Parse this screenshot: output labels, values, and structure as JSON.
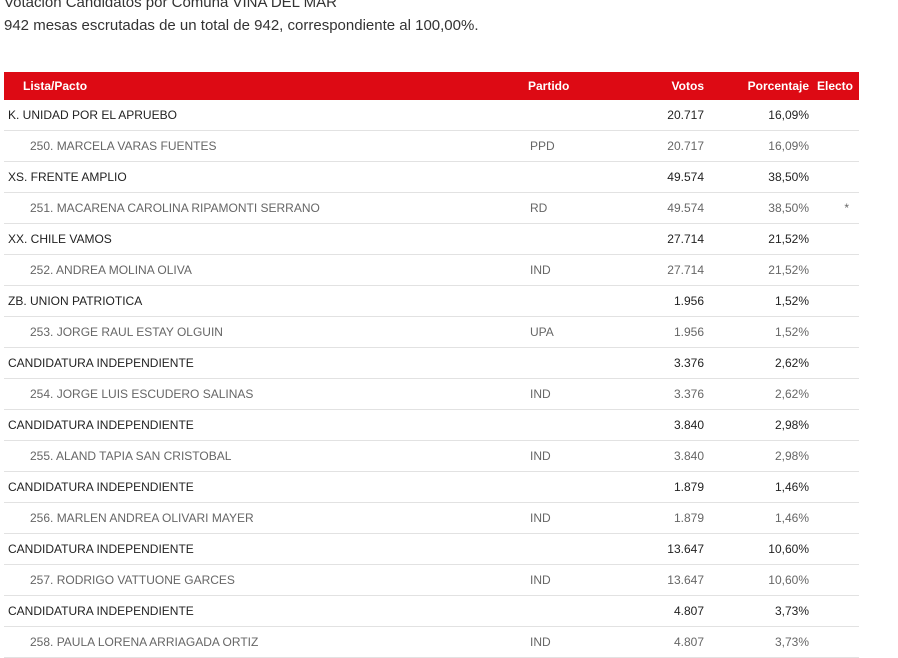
{
  "header": {
    "title": "Votación Candidatos por Comuna VIÑA DEL MAR",
    "subtitle": "942 mesas escrutadas de un total de 942, correspondiente al 100,00%."
  },
  "table": {
    "columns": [
      "Lista/Pacto",
      "Partido",
      "Votos",
      "Porcentaje",
      "Electo"
    ],
    "rows": [
      {
        "type": "pacto",
        "name": "K. UNIDAD POR EL APRUEBO",
        "partido": "",
        "votos": "20.717",
        "porcentaje": "16,09%",
        "electo": ""
      },
      {
        "type": "cand",
        "name": "250. MARCELA VARAS FUENTES",
        "partido": "PPD",
        "votos": "20.717",
        "porcentaje": "16,09%",
        "electo": ""
      },
      {
        "type": "pacto",
        "name": "XS. FRENTE AMPLIO",
        "partido": "",
        "votos": "49.574",
        "porcentaje": "38,50%",
        "electo": ""
      },
      {
        "type": "cand",
        "name": "251. MACARENA CAROLINA RIPAMONTI SERRANO",
        "partido": "RD",
        "votos": "49.574",
        "porcentaje": "38,50%",
        "electo": "*"
      },
      {
        "type": "pacto",
        "name": "XX. CHILE VAMOS",
        "partido": "",
        "votos": "27.714",
        "porcentaje": "21,52%",
        "electo": ""
      },
      {
        "type": "cand",
        "name": "252. ANDREA MOLINA OLIVA",
        "partido": "IND",
        "votos": "27.714",
        "porcentaje": "21,52%",
        "electo": ""
      },
      {
        "type": "pacto",
        "name": "ZB. UNION PATRIOTICA",
        "partido": "",
        "votos": "1.956",
        "porcentaje": "1,52%",
        "electo": ""
      },
      {
        "type": "cand",
        "name": "253. JORGE RAUL ESTAY OLGUIN",
        "partido": "UPA",
        "votos": "1.956",
        "porcentaje": "1,52%",
        "electo": ""
      },
      {
        "type": "pacto",
        "name": "CANDIDATURA INDEPENDIENTE",
        "partido": "",
        "votos": "3.376",
        "porcentaje": "2,62%",
        "electo": ""
      },
      {
        "type": "cand",
        "name": "254. JORGE LUIS ESCUDERO SALINAS",
        "partido": "IND",
        "votos": "3.376",
        "porcentaje": "2,62%",
        "electo": ""
      },
      {
        "type": "pacto",
        "name": "CANDIDATURA INDEPENDIENTE",
        "partido": "",
        "votos": "3.840",
        "porcentaje": "2,98%",
        "electo": ""
      },
      {
        "type": "cand",
        "name": "255. ALAND TAPIA SAN CRISTOBAL",
        "partido": "IND",
        "votos": "3.840",
        "porcentaje": "2,98%",
        "electo": ""
      },
      {
        "type": "pacto",
        "name": "CANDIDATURA INDEPENDIENTE",
        "partido": "",
        "votos": "1.879",
        "porcentaje": "1,46%",
        "electo": ""
      },
      {
        "type": "cand",
        "name": "256. MARLEN ANDREA OLIVARI MAYER",
        "partido": "IND",
        "votos": "1.879",
        "porcentaje": "1,46%",
        "electo": ""
      },
      {
        "type": "pacto",
        "name": "CANDIDATURA INDEPENDIENTE",
        "partido": "",
        "votos": "13.647",
        "porcentaje": "10,60%",
        "electo": ""
      },
      {
        "type": "cand",
        "name": "257. RODRIGO VATTUONE GARCES",
        "partido": "IND",
        "votos": "13.647",
        "porcentaje": "10,60%",
        "electo": ""
      },
      {
        "type": "pacto",
        "name": "CANDIDATURA INDEPENDIENTE",
        "partido": "",
        "votos": "4.807",
        "porcentaje": "3,73%",
        "electo": ""
      },
      {
        "type": "cand",
        "name": "258. PAULA LORENA ARRIAGADA ORTIZ",
        "partido": "IND",
        "votos": "4.807",
        "porcentaje": "3,73%",
        "electo": ""
      }
    ]
  },
  "colors": {
    "header_bg": "#dd0a14",
    "header_text": "#ffffff",
    "row_border": "#e2e2e2"
  }
}
